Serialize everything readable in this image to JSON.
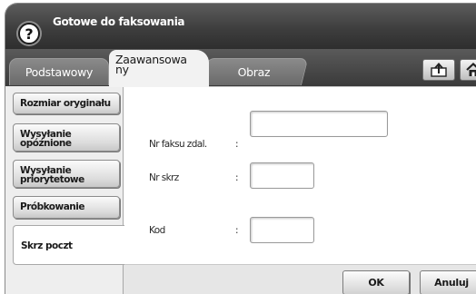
{
  "header": {
    "title": "Gotowe do faksowania",
    "help_glyph": "?"
  },
  "tabs": [
    {
      "label": "Podstawowy",
      "active": false
    },
    {
      "label": "Zaawansowa\nny",
      "active": true
    },
    {
      "label": "Obraz",
      "active": false
    }
  ],
  "toolbar_icons": [
    "back-icon",
    "home-icon"
  ],
  "sidebar": {
    "items": [
      {
        "label": "Rozmiar oryginału",
        "selected": false
      },
      {
        "label": "Wysyłanie\nopóźnione",
        "selected": false
      },
      {
        "label": "Wysyłanie\npriorytetowe",
        "selected": false
      },
      {
        "label": "Próbkowanie",
        "selected": false
      },
      {
        "label": "Skrz poczt",
        "selected": true
      }
    ]
  },
  "form": {
    "fields": [
      {
        "label": "Nr faksu zdal.",
        "separator": ":",
        "value": ""
      },
      {
        "label": "Nr skrz",
        "separator": ":",
        "value": ""
      },
      {
        "label": "Kod",
        "separator": ":",
        "value": ""
      }
    ]
  },
  "actions": {
    "ok_label": "OK",
    "cancel_label": "Anuluj"
  },
  "colors": {
    "titlebar": "#3e3e3e",
    "panel": "#ffffff",
    "sidebar": "#eeeeee"
  }
}
